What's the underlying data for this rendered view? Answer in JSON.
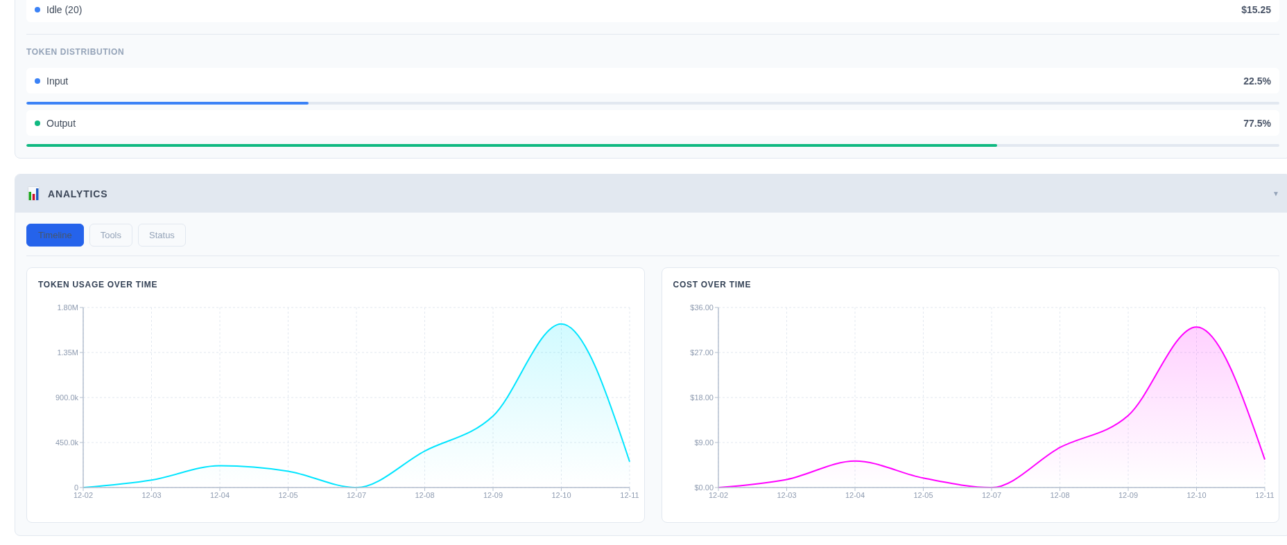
{
  "status_costs": [
    {
      "label": "Idle (20)",
      "value": "$15.25",
      "color": "#3b82f6"
    }
  ],
  "token_distribution": {
    "heading": "TOKEN DISTRIBUTION",
    "items": [
      {
        "label": "Input",
        "value": "22.5%",
        "color": "#3b82f6",
        "level": 0.225
      },
      {
        "label": "Output",
        "value": "77.5%",
        "color": "#10b981",
        "level": 0.775
      }
    ]
  },
  "analytics": {
    "title": "ANALYTICS",
    "toggle": "▼",
    "tabs": [
      {
        "label": "Timeline",
        "selected": true
      },
      {
        "label": "Tools",
        "selected": false
      },
      {
        "label": "Status",
        "selected": false
      }
    ],
    "charts": [
      {
        "chart_data": {
          "type": "area",
          "title": "TOKEN USAGE OVER TIME",
          "grid": true,
          "categories": [
            "12-02",
            "12-03",
            "12-04",
            "12-05",
            "12-07",
            "12-08",
            "12-09",
            "12-10",
            "12-11"
          ],
          "series": [
            {
              "color": "#00e5ff",
              "values": [
                0,
                75000,
                218000,
                163000,
                0,
                365000,
                715000,
                1636000,
                258000
              ]
            }
          ],
          "ylim": [
            0,
            1800000
          ],
          "yticks": [
            {
              "value": 0,
              "label": "0"
            },
            {
              "value": 450000,
              "label": "450.0k"
            },
            {
              "value": 900000,
              "label": "900.0k"
            },
            {
              "value": 1350000,
              "label": "1.35M"
            },
            {
              "value": 1800000,
              "label": "1.80M"
            }
          ]
        }
      },
      {
        "chart_data": {
          "type": "area",
          "title": "COST OVER TIME",
          "grid": true,
          "categories": [
            "12-02",
            "12-03",
            "12-04",
            "12-05",
            "12-07",
            "12-08",
            "12-09",
            "12-10",
            "12-11"
          ],
          "series": [
            {
              "color": "#ff00ff",
              "values": [
                0,
                1.6,
                5.3,
                1.9,
                0,
                8.0,
                14.4,
                32.1,
                5.6
              ]
            }
          ],
          "ylim": [
            0,
            36
          ],
          "yticks": [
            {
              "value": 0,
              "label": "$0.00"
            },
            {
              "value": 9,
              "label": "$9.00"
            },
            {
              "value": 18,
              "label": "$18.00"
            },
            {
              "value": 27,
              "label": "$27.00"
            },
            {
              "value": 36,
              "label": "$36.00"
            }
          ]
        }
      }
    ]
  }
}
